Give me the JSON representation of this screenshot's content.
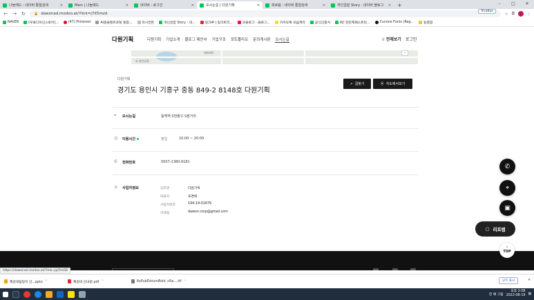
{
  "tabs": [
    {
      "label": "나눔에드 : 네이버 통합검색",
      "active": false
    },
    {
      "label": "Main | 나눔에드",
      "active": false
    },
    {
      "label": "네이버 : 로그인",
      "active": false
    },
    {
      "label": "오시는길 | 다원기획",
      "active": true
    },
    {
      "label": "피로림 : 네이버 통합검색",
      "active": false
    },
    {
      "label": "개인길잡 Story : 네이버 블로그",
      "active": false
    }
  ],
  "window_controls": {
    "minimize": "–",
    "maximize": "□",
    "close": "✕"
  },
  "terabox_label": "TeraBox",
  "address": {
    "url": "dawonad.modoo.at/?link=j7it5mzd"
  },
  "bookmarks": [
    "NAVER",
    "[우표디자인스토어]...",
    "(47) Pinterest",
    "AI홈플랜트포털 통합...",
    "마시면돈",
    "개인길잡 Story : 네...",
    "링크루 | 링크트리...",
    "모블로그 - 블로그...",
    "카카오톡 모음제작",
    "공식인증서",
    "W) 한만제패스트킹...",
    "Cursive Fonts (Reg...",
    "동종합"
  ],
  "site": {
    "logo": "다원기획",
    "menu": [
      "다원기획",
      "기업소개",
      "블로그 제안서",
      "기업구조",
      "포트폴리오",
      "문의게시판",
      "오시는길"
    ],
    "active_menu": "오시는길",
    "util_all": "전체보기",
    "util_login": "로그인"
  },
  "map": {
    "label_a": "테마피트",
    "label_b": "호 용인공원",
    "zoom": "–"
  },
  "place": {
    "small_title": "다원기획",
    "address": "경기도 용인시 기흥구 중동 849-2 8148호 다원기획",
    "route_button": "길찾기",
    "map_button": "지도에서보기"
  },
  "rows": {
    "directions": {
      "label": "오시는길",
      "value": "동백역 5번출구 5분거리"
    },
    "hours": {
      "label": "이용시간",
      "day": "평일",
      "time": "10:00 ~ 20:00"
    },
    "phone": {
      "label": "전화번호",
      "value": "0507-1380-9181"
    },
    "business": {
      "label": "사업자정보",
      "items": [
        {
          "k": "상호명",
          "v": "다원기획"
        },
        {
          "k": "대표자",
          "v": "조경애"
        },
        {
          "k": "사업자번호",
          "v": "194-19-01679"
        },
        {
          "k": "이메일",
          "v": "dawon.corp@gmail.com"
        }
      ]
    }
  },
  "floating": {
    "reply_label": "리프렙",
    "top_label": "TOP"
  },
  "status_url": "https://dawonad.modoo.at/?link=jq7tm58",
  "downloads": [
    {
      "name": "폭원대답일지 안...pptx",
      "type": "zip"
    },
    {
      "name": "폭원대 안내문.pdf",
      "type": "pdf"
    },
    {
      "name": "KoPubDotumBold +Ra....ttf",
      "type": "ttf"
    }
  ],
  "downloads_showall": "모두 표시",
  "taskbar": {
    "time": "오후 2:08",
    "date": "2022-08-19",
    "tray_text": "한 예 그림"
  },
  "colors": {
    "accent_green": "#03c75a",
    "dark": "#111111"
  }
}
